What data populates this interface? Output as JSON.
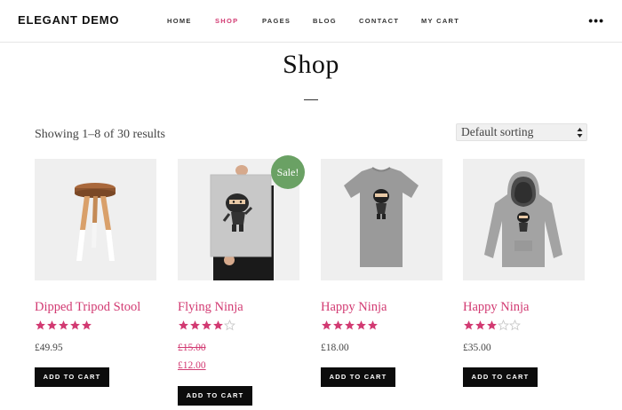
{
  "header": {
    "logo": "ELEGANT DEMO",
    "nav": [
      {
        "label": "HOME",
        "active": false
      },
      {
        "label": "SHOP",
        "active": true
      },
      {
        "label": "PAGES",
        "active": false
      },
      {
        "label": "BLOG",
        "active": false
      },
      {
        "label": "CONTACT",
        "active": false
      },
      {
        "label": "MY CART",
        "active": false
      }
    ],
    "more_icon": "more-dots-icon"
  },
  "page": {
    "title": "Shop",
    "result_count": "Showing 1–8 of 30 results",
    "sorting": {
      "selected": "Default sorting"
    }
  },
  "products": [
    {
      "name": "Dipped Tripod Stool",
      "rating": 5,
      "price": "£49.95",
      "add_to_cart": "ADD TO CART",
      "on_sale": false
    },
    {
      "name": "Flying Ninja",
      "rating": 4,
      "regular_price": "£15.00",
      "sale_price": "£12.00",
      "add_to_cart": "ADD TO CART",
      "on_sale": true,
      "badge": "Sale!"
    },
    {
      "name": "Happy Ninja",
      "rating": 5,
      "price": "£18.00",
      "add_to_cart": "ADD TO CART",
      "on_sale": false
    },
    {
      "name": "Happy Ninja",
      "rating": 3,
      "price": "£35.00",
      "add_to_cart": "ADD TO CART",
      "on_sale": false
    }
  ],
  "colors": {
    "accent": "#d23a72",
    "sale_badge": "#6aa164",
    "button": "#0c0c0c"
  }
}
